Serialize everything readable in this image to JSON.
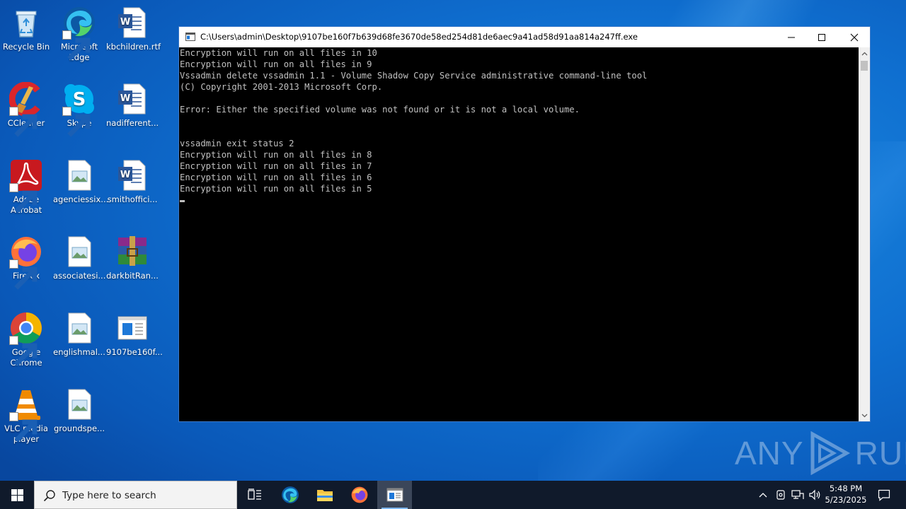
{
  "desktop": {
    "icons": [
      {
        "label": "Recycle Bin"
      },
      {
        "label": "Microsoft Edge"
      },
      {
        "label": "kbchildren.rtf"
      },
      {
        "label": "CCleaner"
      },
      {
        "label": "Skype"
      },
      {
        "label": "nadifferent..."
      },
      {
        "label": "Adobe Acrobat"
      },
      {
        "label": "agenciessix..."
      },
      {
        "label": "smithoffici..."
      },
      {
        "label": "Firefox"
      },
      {
        "label": "associatesi..."
      },
      {
        "label": "darkbitRan..."
      },
      {
        "label": "Google Chrome"
      },
      {
        "label": "englishmal..."
      },
      {
        "label": "9107be160f..."
      },
      {
        "label": "VLC media player"
      },
      {
        "label": "groundspe..."
      }
    ]
  },
  "console": {
    "title": "C:\\Users\\admin\\Desktop\\9107be160f7b639d68fe3670de58ed254d81de6aec9a41ad58d91aa814a247ff.exe",
    "lines": [
      "Encryption will run on all files in 10",
      "Encryption will run on all files in 9",
      "Vssadmin delete vssadmin 1.1 - Volume Shadow Copy Service administrative command-line tool",
      "(C) Copyright 2001-2013 Microsoft Corp.",
      "",
      "Error: Either the specified volume was not found or it is not a local volume.",
      "",
      "",
      "vssadmin exit status 2",
      "Encryption will run on all files in 8",
      "Encryption will run on all files in 7",
      "Encryption will run on all files in 6",
      "Encryption will run on all files in 5"
    ]
  },
  "watermark": {
    "left": "ANY",
    "right": "RUN"
  },
  "taskbar": {
    "search_placeholder": "Type here to search",
    "time": "5:48 PM",
    "date": "5/23/2025"
  },
  "colors": {
    "desktop_blue": "#0f6fd0",
    "taskbar": "#101a2b",
    "console_text": "#c0c0c0"
  }
}
